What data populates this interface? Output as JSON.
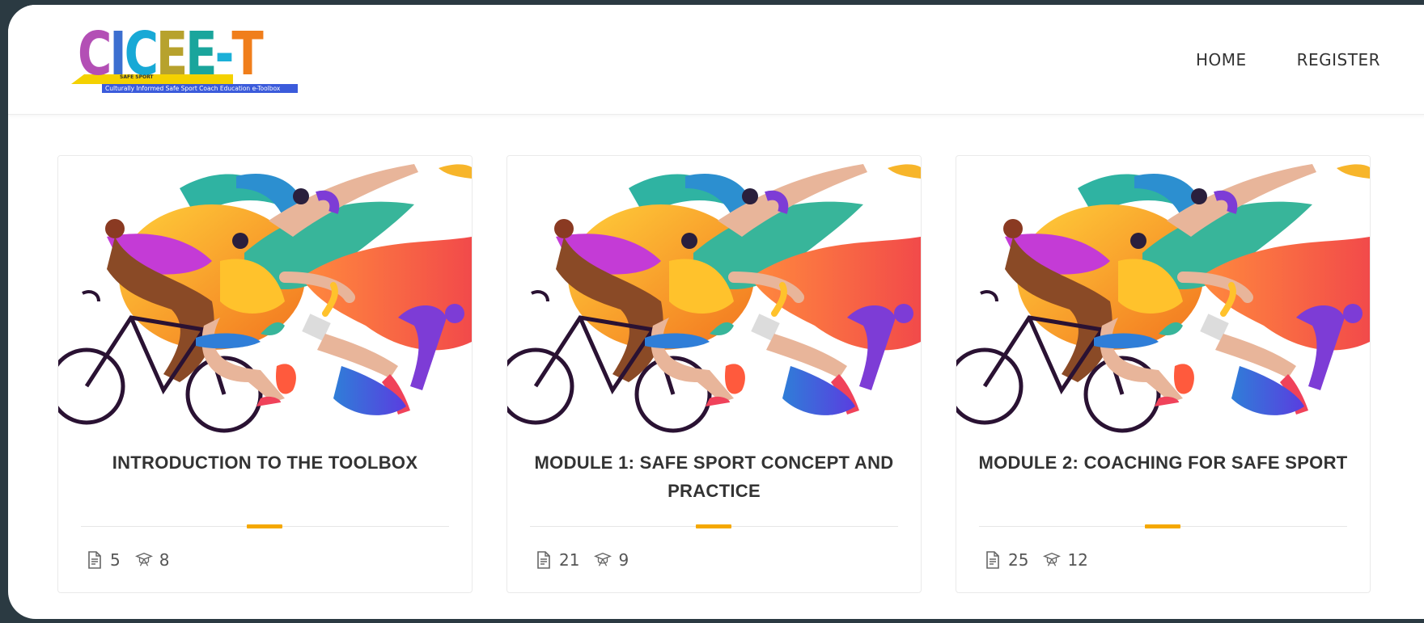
{
  "brand": {
    "letters": [
      "C",
      "I",
      "C",
      "E",
      "E",
      "-",
      "T"
    ],
    "letter_colors": [
      "#b34fb5",
      "#3c6fd0",
      "#18a9d6",
      "#b7a22d",
      "#1aa59c",
      "#1bb0d8",
      "#f07e1b"
    ],
    "safe_sport": "SAFE SPORT",
    "tagline": "Culturally Informed Safe Sport Coach Education e-Toolbox"
  },
  "nav": {
    "home": "HOME",
    "register": "REGISTER"
  },
  "cards": [
    {
      "title": "INTRODUCTION TO THE TOOLBOX",
      "lessons": "5",
      "students": "8"
    },
    {
      "title": "MODULE 1: SAFE SPORT CONCEPT AND PRACTICE",
      "lessons": "21",
      "students": "9"
    },
    {
      "title": "MODULE 2: COACHING FOR SAFE SPORT",
      "lessons": "25",
      "students": "12"
    }
  ],
  "colors": {
    "accent": "#f5a800",
    "text": "#333333"
  },
  "icons": {
    "lessons": "document-icon",
    "students": "graduation-cap-icon"
  }
}
